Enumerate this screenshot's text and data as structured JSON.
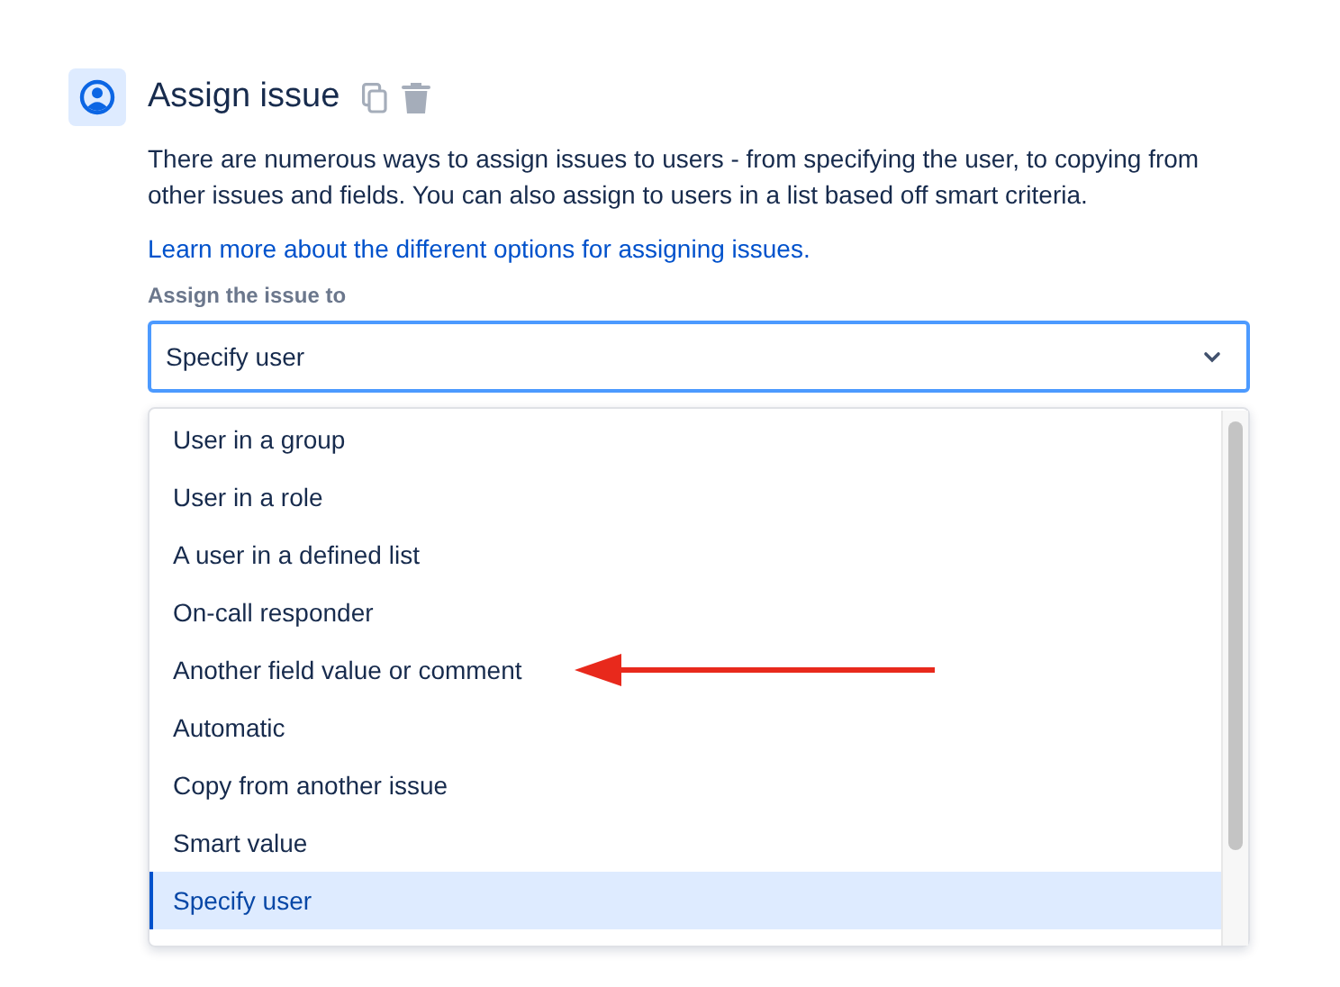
{
  "action": {
    "title": "Assign issue",
    "description": "There are numerous ways to assign issues to users - from specifying the user, to copying from other issues and fields. You can also assign to users in a list based off smart criteria.",
    "link": "Learn more about the different options for assigning issues."
  },
  "field": {
    "label": "Assign the issue to",
    "value": "Specify user"
  },
  "options": [
    {
      "label": "User in a group",
      "selected": false
    },
    {
      "label": "User in a role",
      "selected": false
    },
    {
      "label": "A user in a defined list",
      "selected": false
    },
    {
      "label": "On-call responder",
      "selected": false
    },
    {
      "label": "Another field value or comment",
      "selected": false,
      "pointed": true
    },
    {
      "label": "Automatic",
      "selected": false
    },
    {
      "label": "Copy from another issue",
      "selected": false
    },
    {
      "label": "Smart value",
      "selected": false
    },
    {
      "label": "Specify user",
      "selected": true
    }
  ]
}
